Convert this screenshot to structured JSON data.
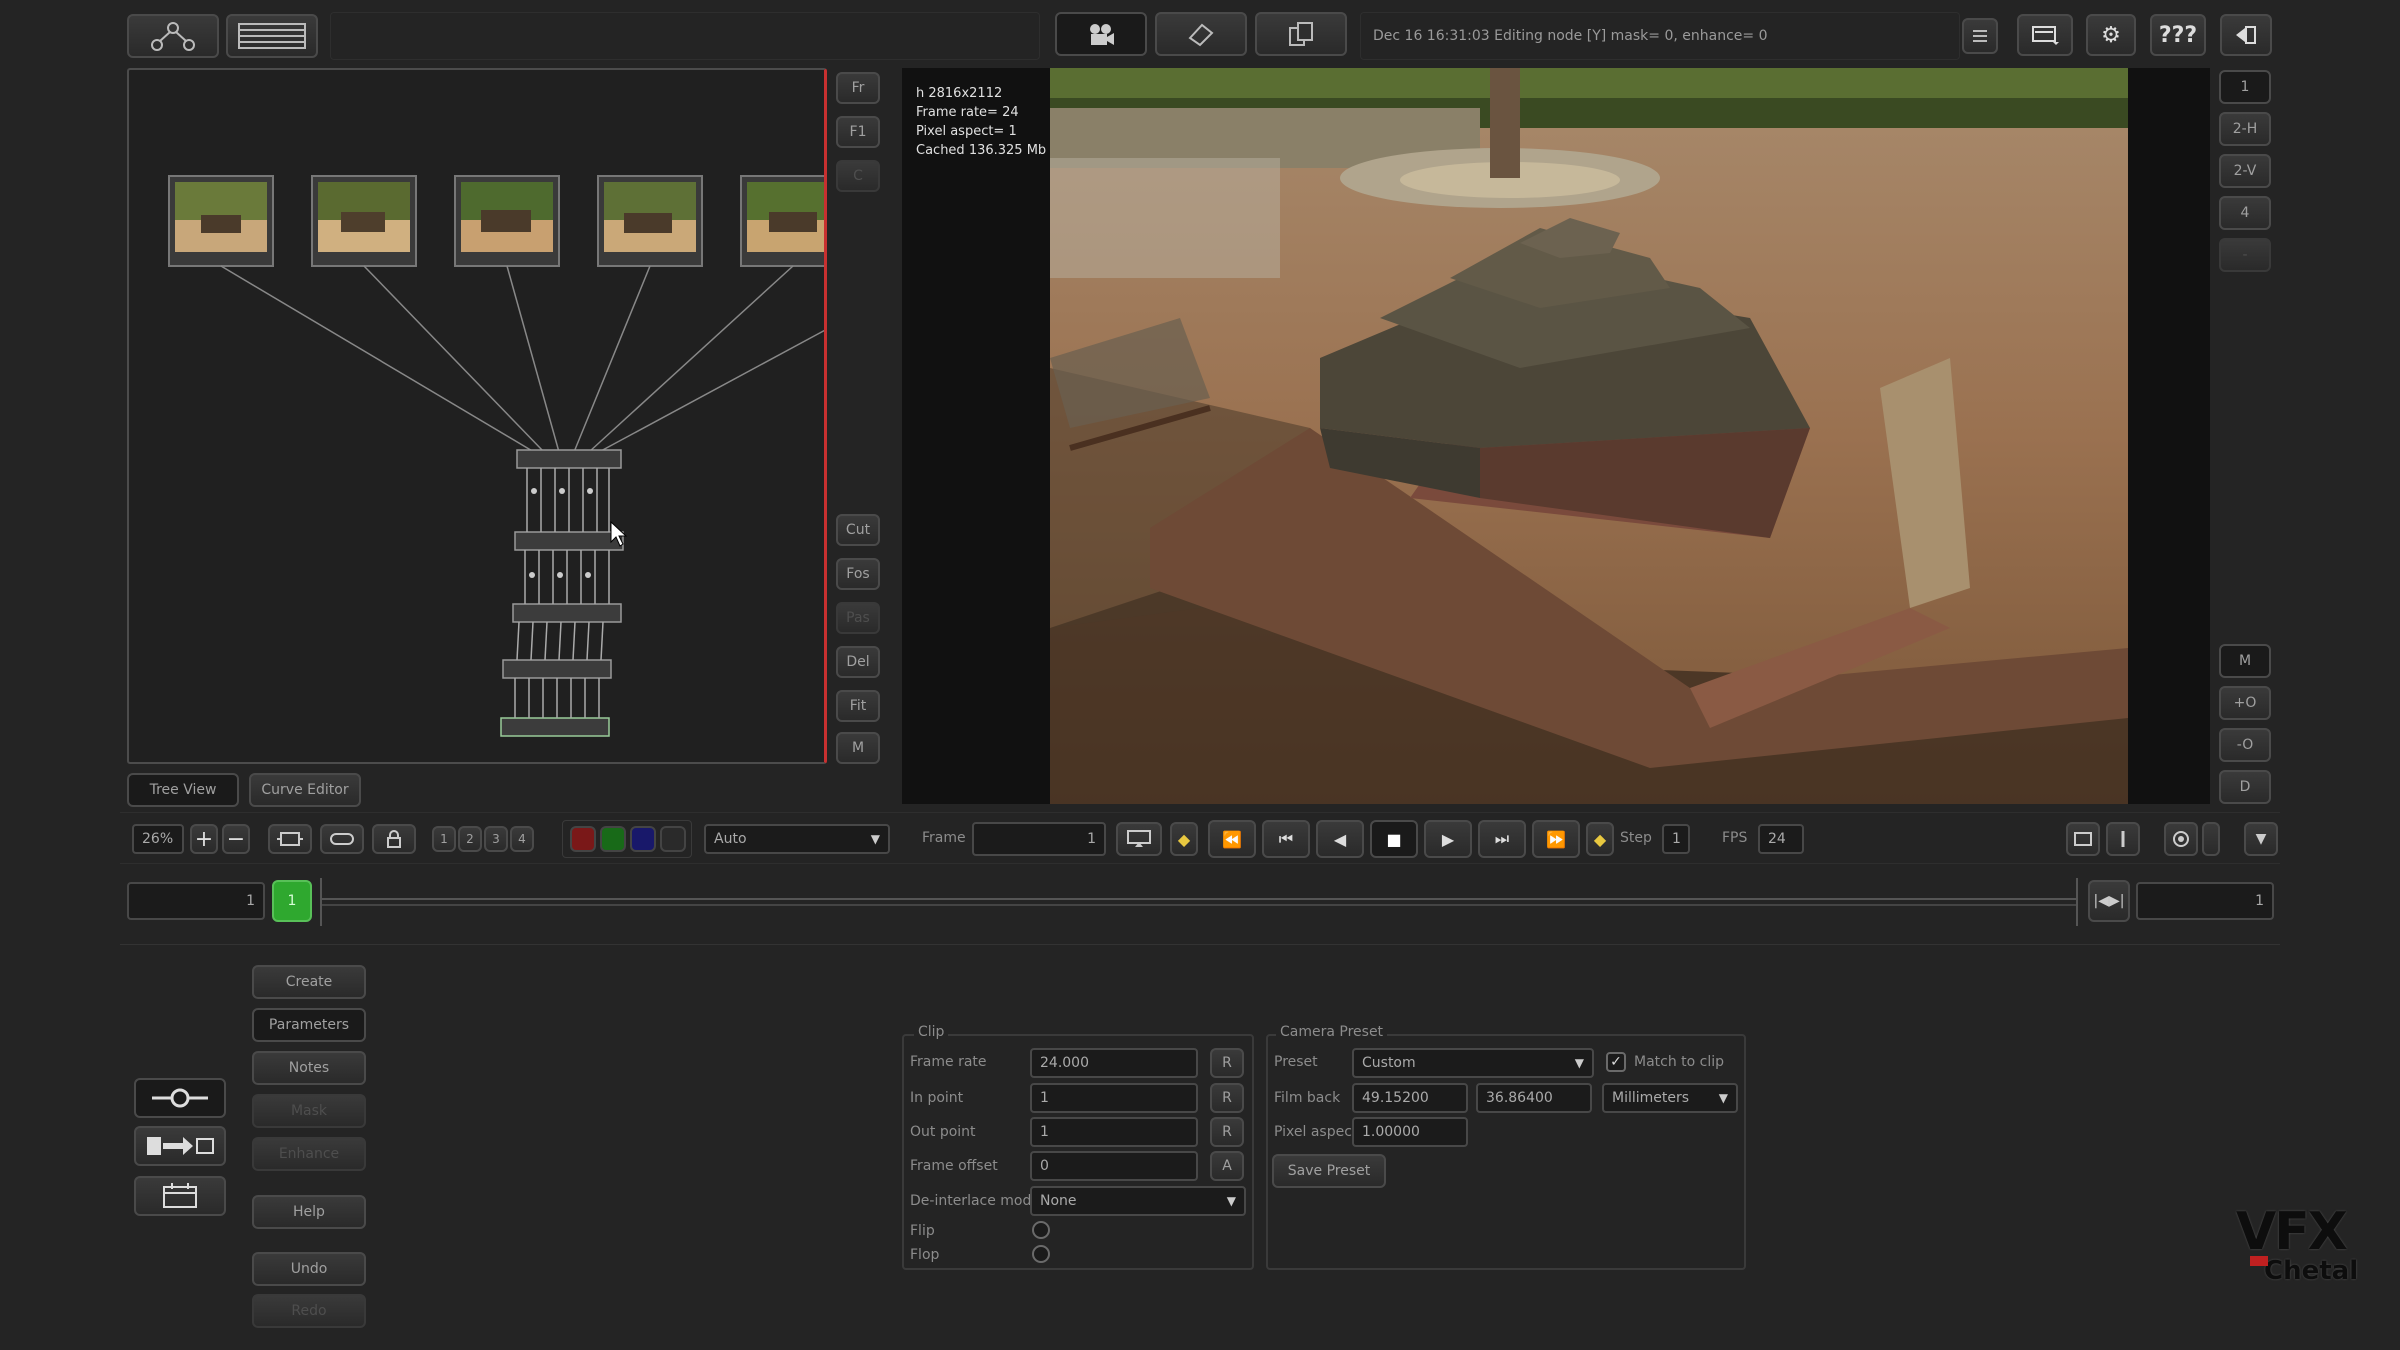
{
  "top_bar": {
    "status_text": "Dec 16 16:31:03 Editing node [Y] mask= 0, enhance= 0",
    "help_label": "???"
  },
  "node_editor": {
    "side_buttons_top": [
      "Fr",
      "F1",
      "C"
    ],
    "side_buttons_bottom": [
      "Cut",
      "Fos",
      "Pas",
      "Del",
      "Fit",
      "M"
    ],
    "tabs": [
      "Tree View",
      "Curve Editor"
    ]
  },
  "viewer": {
    "info": {
      "resolution": "h 2816x2112",
      "frame_rate": "Frame rate= 24",
      "pixel_aspect": "Pixel aspect= 1",
      "cached": "Cached 136.325 Mb"
    },
    "right_buttons_top": [
      "1",
      "2-H",
      "2-V",
      "4",
      "-"
    ],
    "right_buttons_bottom": [
      "M",
      "+O",
      "-O",
      "D"
    ]
  },
  "view_controls": {
    "zoom": "26%",
    "channel_numbers": [
      "1",
      "2",
      "3",
      "4"
    ],
    "layer_mode": "Auto",
    "frame_label": "Frame",
    "frame_value": "1",
    "step_label": "Step",
    "step_value": "1",
    "fps_label": "FPS",
    "fps_value": "24"
  },
  "timeline": {
    "start_frame": "1",
    "marker": "1",
    "end_frame": "1"
  },
  "actions": [
    "Create",
    "Parameters",
    "Notes",
    "Mask",
    "Enhance",
    "Help",
    "Undo",
    "Redo"
  ],
  "clip": {
    "section_label": "Clip",
    "frame_rate_label": "Frame rate",
    "frame_rate": "24.000",
    "in_point_label": "In point",
    "in_point": "1",
    "out_point_label": "Out point",
    "out_point": "1",
    "frame_offset_label": "Frame offset",
    "frame_offset": "0",
    "deinterlace_label": "De-interlace mode",
    "deinterlace": "None",
    "flip_label": "Flip",
    "flop_label": "Flop",
    "reset_btn": "R",
    "fix_btn": "A"
  },
  "camera": {
    "section_label": "Camera Preset",
    "preset_label": "Preset",
    "preset": "Custom",
    "match_label": "Match to clip",
    "film_back_label": "Film back",
    "film_back_w": "49.15200",
    "film_back_h": "36.86400",
    "units": "Millimeters",
    "pixel_aspect_label": "Pixel aspect",
    "pixel_aspect": "1.00000",
    "save_label": "Save Preset"
  },
  "watermark": {
    "line1": "VFX",
    "line2": "Chetal"
  },
  "colors": {
    "background": "#242424",
    "accent_green": "#2fa82f",
    "red_divider": "#c83030"
  }
}
